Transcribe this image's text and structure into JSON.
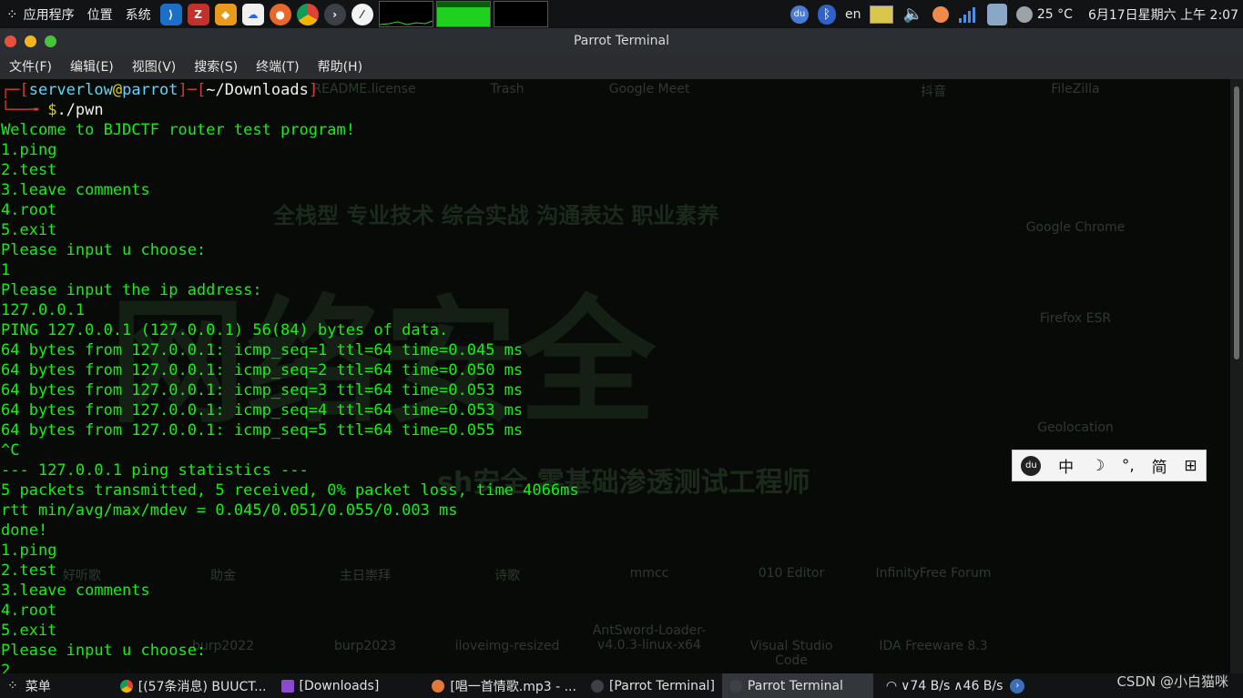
{
  "top_panel": {
    "apps_label": "应用程序",
    "places_label": "位置",
    "system_label": "系统",
    "tray": {
      "keyboard_layout": "en",
      "weather": "25 °C",
      "clock": "6月17日星期六 上午 2:07"
    }
  },
  "window": {
    "title": "Parrot Terminal"
  },
  "menubar": {
    "items": [
      "文件(F)",
      "编辑(E)",
      "视图(V)",
      "搜索(S)",
      "终端(T)",
      "帮助(H)"
    ]
  },
  "terminal": {
    "prompt": {
      "user": "serverlow",
      "at": "@",
      "host": "parrot",
      "path": "~/Downloads",
      "dollar": "$",
      "command": "./pwn"
    },
    "lines": [
      "Welcome to BJDCTF router test program!",
      "1.ping",
      "2.test",
      "3.leave comments",
      "4.root",
      "5.exit",
      "Please input u choose:",
      "1",
      "Please input the ip address:",
      "127.0.0.1",
      "PING 127.0.0.1 (127.0.0.1) 56(84) bytes of data.",
      "64 bytes from 127.0.0.1: icmp_seq=1 ttl=64 time=0.045 ms",
      "64 bytes from 127.0.0.1: icmp_seq=2 ttl=64 time=0.050 ms",
      "64 bytes from 127.0.0.1: icmp_seq=3 ttl=64 time=0.053 ms",
      "64 bytes from 127.0.0.1: icmp_seq=4 ttl=64 time=0.053 ms",
      "64 bytes from 127.0.0.1: icmp_seq=5 ttl=64 time=0.055 ms",
      "^C",
      "--- 127.0.0.1 ping statistics ---",
      "5 packets transmitted, 5 received, 0% packet loss, time 4066ms",
      "rtt min/avg/max/mdev = 0.045/0.051/0.055/0.003 ms",
      "done!",
      "1.ping",
      "2.test",
      "3.leave comments",
      "4.root",
      "5.exit",
      "Please input u choose:",
      "2"
    ],
    "background_desktop_labels": {
      "top": [
        "README.license",
        "Trash",
        "Google Meet",
        "抖音",
        "FileZilla"
      ],
      "right": [
        "Google Chrome",
        "Firefox ESR",
        "Geolocation"
      ],
      "row1": [
        "好听歌",
        "助金",
        "主日崇拜",
        "诗歌",
        "mmcc",
        "010 Editor",
        "InfinityFree Forum"
      ],
      "row2": [
        "burp2022",
        "burp2023",
        "iloveimg-resized",
        "AntSword-Loader-v4.0.3-linux-x64",
        "Visual Studio Code",
        "IDA Freeware 8.3"
      ]
    },
    "wallpaper_text": {
      "slogan": "全栈型 专业技术 综合实战 沟通表达 职业素养",
      "big": "网络安全",
      "sub": "sh安全 零基础渗透测试工程师"
    }
  },
  "ime_bar": {
    "items": [
      "中",
      "☽",
      "°,",
      "简",
      "⊞"
    ]
  },
  "taskbar": {
    "menu_label": "菜单",
    "tasks": [
      "[(57条消息) BUUCT...",
      "[Downloads]",
      "[唱一首情歌.mp3 - ...",
      "[Parrot Terminal]",
      "Parrot Terminal"
    ],
    "net_down": "74 B/s",
    "net_up": "46 B/s",
    "watermark": "CSDN @小白猫咪"
  }
}
